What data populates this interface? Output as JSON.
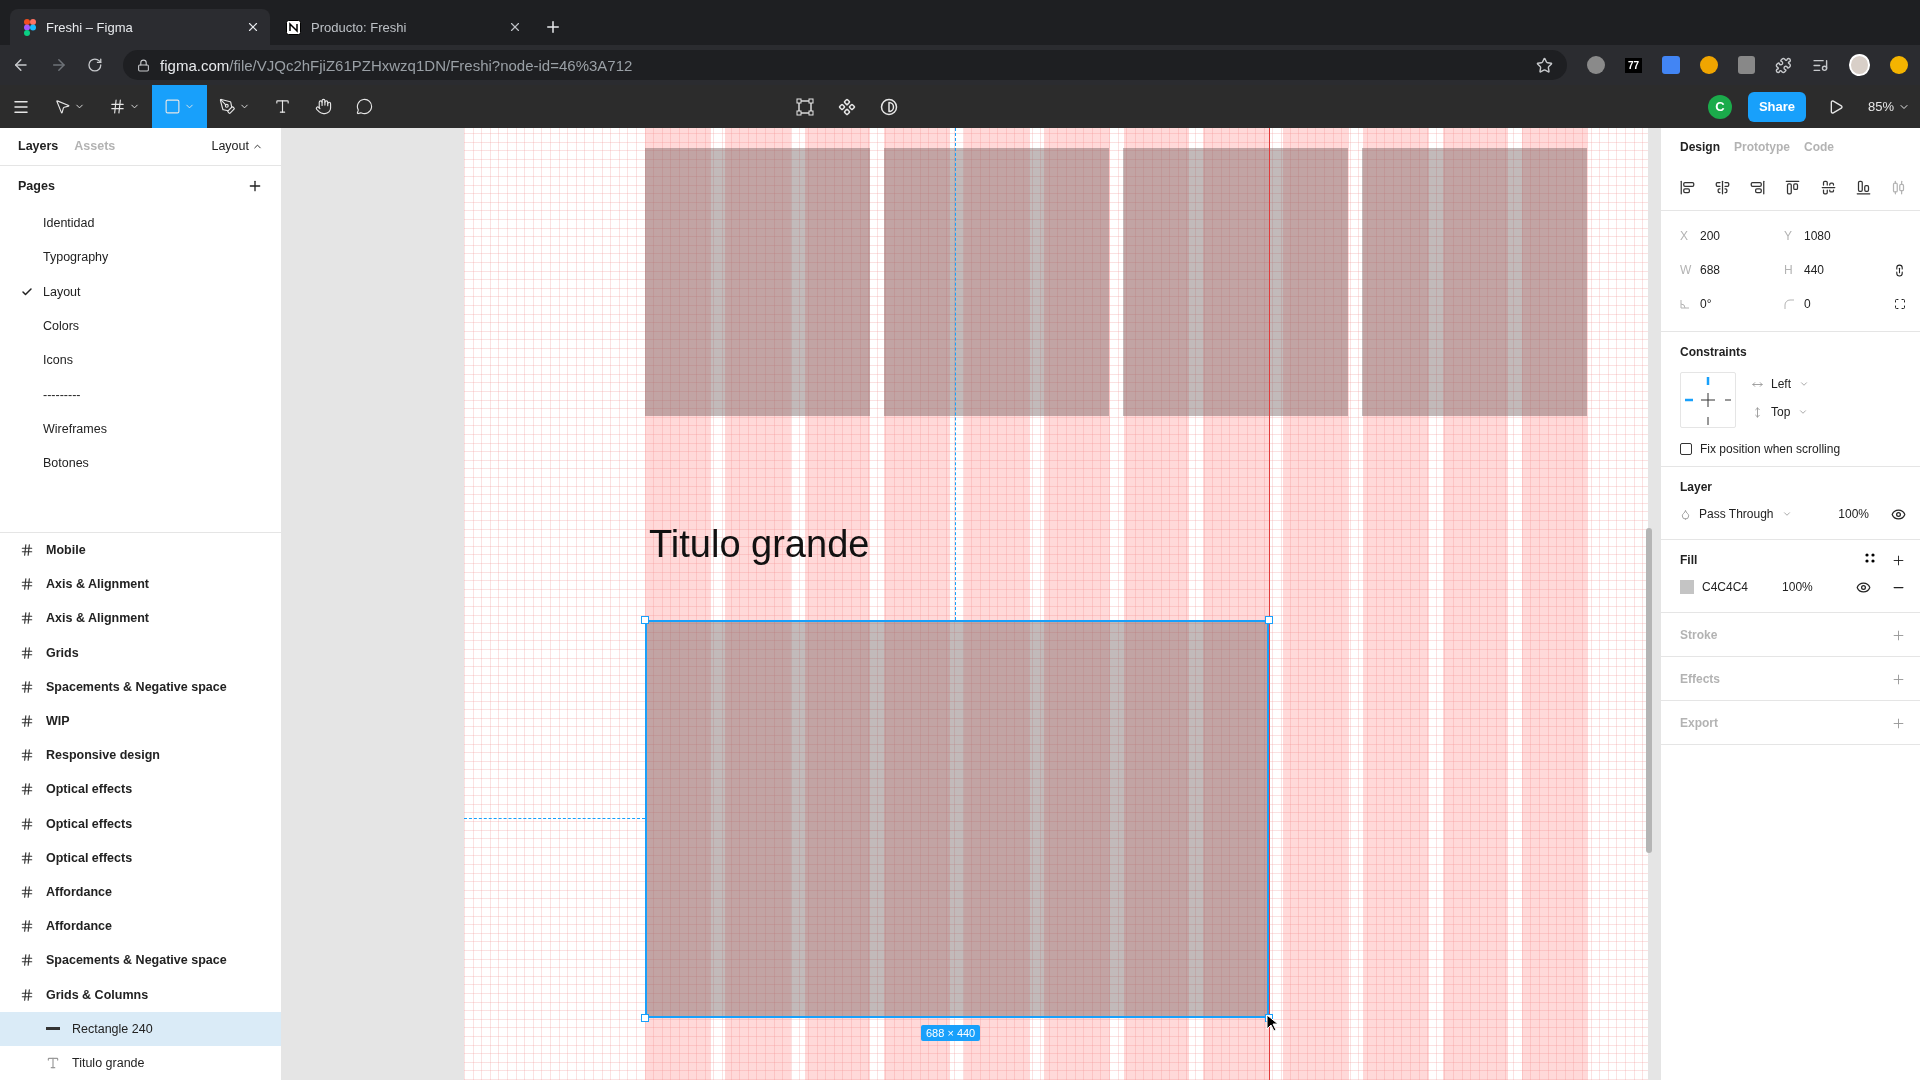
{
  "browser": {
    "tabs": [
      {
        "title": "Freshi – Figma",
        "kind": "figma",
        "selected": true
      },
      {
        "title": "Producto: Freshi",
        "kind": "notion",
        "selected": false
      }
    ],
    "address": {
      "domain": "figma.com",
      "path": "/file/VJQc2hFjiZ61PZHxwzq1DN/Freshi?node-id=46%3A712"
    },
    "extension_badge": "77"
  },
  "toolbar": {
    "tools": [
      {
        "kind": "move",
        "selected": false,
        "menu": true
      },
      {
        "kind": "frame",
        "selected": false,
        "menu": true
      },
      {
        "kind": "rectangle",
        "selected": true,
        "menu": true
      },
      {
        "kind": "pen",
        "selected": false,
        "menu": true
      },
      {
        "kind": "text",
        "selected": false,
        "menu": false
      },
      {
        "kind": "hand",
        "selected": false,
        "menu": false
      },
      {
        "kind": "comment",
        "selected": false,
        "menu": false
      }
    ],
    "user_initial": "C",
    "share": "Share",
    "zoom": "85%"
  },
  "left_panel": {
    "tabs": [
      {
        "label": "Layers",
        "selected": true
      },
      {
        "label": "Assets",
        "selected": false
      }
    ],
    "page_menu": "Layout",
    "pages_title": "Pages",
    "pages": [
      {
        "name": "Identidad",
        "selected": false
      },
      {
        "name": "Typography",
        "selected": false
      },
      {
        "name": "Layout",
        "selected": true
      },
      {
        "name": "Colors",
        "selected": false
      },
      {
        "name": "Icons",
        "selected": false
      },
      {
        "name": "---------",
        "selected": false
      },
      {
        "name": "Wireframes",
        "selected": false
      },
      {
        "name": "Botones",
        "selected": false
      }
    ],
    "layers": [
      {
        "name": "Mobile",
        "kind": "frame",
        "selected": false
      },
      {
        "name": "Axis & Alignment",
        "kind": "frame",
        "selected": false
      },
      {
        "name": "Axis & Alignment",
        "kind": "frame",
        "selected": false
      },
      {
        "name": "Grids",
        "kind": "frame",
        "selected": false
      },
      {
        "name": "Spacements & Negative space",
        "kind": "frame",
        "selected": false
      },
      {
        "name": "WIP",
        "kind": "frame",
        "selected": false
      },
      {
        "name": "Responsive design",
        "kind": "frame",
        "selected": false
      },
      {
        "name": "Optical effects",
        "kind": "frame",
        "selected": false
      },
      {
        "name": "Optical effects",
        "kind": "frame",
        "selected": false
      },
      {
        "name": "Optical effects",
        "kind": "frame",
        "selected": false
      },
      {
        "name": "Affordance",
        "kind": "frame",
        "selected": false
      },
      {
        "name": "Affordance",
        "kind": "frame",
        "selected": false
      },
      {
        "name": "Spacements & Negative space",
        "kind": "frame",
        "selected": false
      },
      {
        "name": "Grids & Columns",
        "kind": "frame",
        "selected": false,
        "children": [
          {
            "name": "Rectangle 240",
            "kind": "rectangle",
            "selected": true
          },
          {
            "name": "Titulo grande",
            "kind": "text",
            "selected": false
          }
        ]
      }
    ]
  },
  "canvas": {
    "title": "Titulo grande",
    "selection_size": "688 × 440"
  },
  "right_panel": {
    "tabs": [
      {
        "label": "Design",
        "selected": true
      },
      {
        "label": "Prototype",
        "selected": false
      },
      {
        "label": "Code",
        "selected": false
      }
    ],
    "fields": [
      {
        "kind": "label",
        "label": "X",
        "value": "200"
      },
      {
        "kind": "label",
        "label": "Y",
        "value": "1080"
      },
      {
        "kind": "label",
        "label": "W",
        "value": "688"
      },
      {
        "kind": "label",
        "label": "H",
        "value": "440"
      },
      {
        "kind": "rotation",
        "value": "0°"
      },
      {
        "kind": "radius",
        "value": "0"
      }
    ],
    "constraints": {
      "title": "Constraints",
      "horizontal": "Left",
      "vertical": "Top"
    },
    "fix_position": {
      "label": "Fix position when scrolling",
      "checked": false
    },
    "layer": {
      "title": "Layer",
      "blend": "Pass Through",
      "opacity": "100%"
    },
    "fill": {
      "title": "Fill",
      "hex": "C4C4C4",
      "opacity": "100%"
    },
    "sections": [
      "Stroke",
      "Effects",
      "Export"
    ]
  }
}
